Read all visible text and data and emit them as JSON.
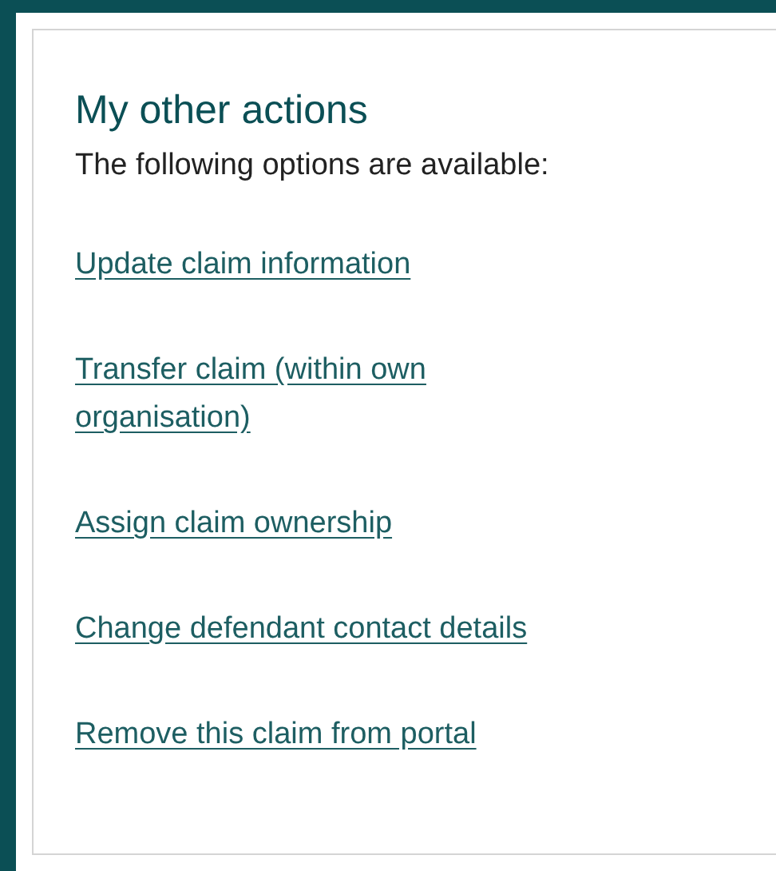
{
  "heading": "My other actions",
  "intro": "The following options are available:",
  "links": [
    "Update claim information",
    "Transfer claim (within own organisation)",
    "Assign claim ownership",
    "Change defendant contact details",
    "Remove this claim from portal"
  ]
}
